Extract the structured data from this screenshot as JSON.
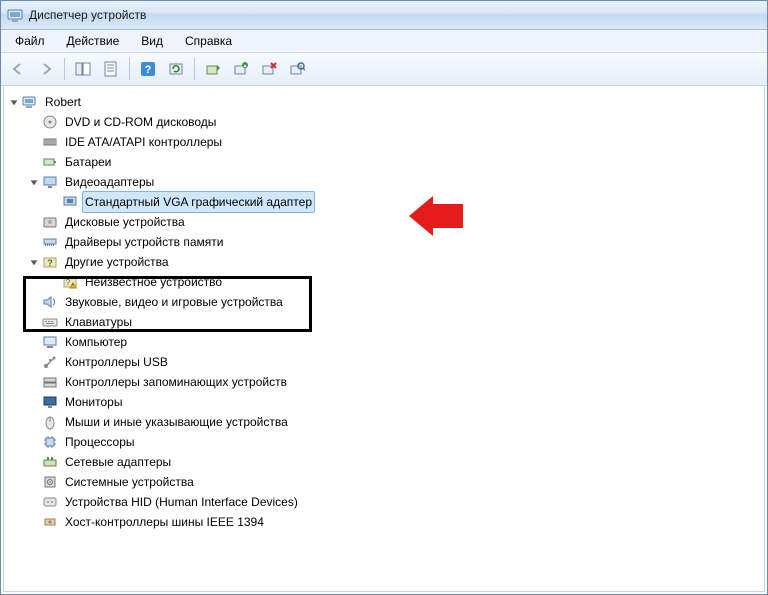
{
  "window": {
    "title": "Диспетчер устройств"
  },
  "menu": {
    "file": "Файл",
    "action": "Действие",
    "view": "Вид",
    "help": "Справка"
  },
  "toolbar": {
    "back": "back",
    "forward": "forward",
    "show_hide": "show-hide-console",
    "properties": "properties",
    "help": "help",
    "refresh": "refresh",
    "update_driver": "update-driver",
    "uninstall": "uninstall",
    "disable": "disable",
    "scan": "scan-hardware"
  },
  "tree": {
    "root": {
      "label": "Robert",
      "icon": "computer-root"
    },
    "items": [
      {
        "label": "DVD и CD-ROM дисководы",
        "icon": "cd-drive",
        "expanded": false
      },
      {
        "label": "IDE ATA/ATAPI контроллеры",
        "icon": "ide",
        "expanded": false
      },
      {
        "label": "Батареи",
        "icon": "battery",
        "expanded": false
      },
      {
        "label": "Видеоадаптеры",
        "icon": "display",
        "expanded": true,
        "children": [
          {
            "label": "Стандартный VGA графический адаптер",
            "icon": "display-chip",
            "selected": true
          }
        ]
      },
      {
        "label": "Дисковые устройства",
        "icon": "disk",
        "expanded": false
      },
      {
        "label": "Драйверы устройств памяти",
        "icon": "memory",
        "expanded": false
      },
      {
        "label": "Другие устройства",
        "icon": "unknown-cat",
        "expanded": true,
        "children": [
          {
            "label": "Неизвестное устройство",
            "icon": "unknown-warn"
          }
        ]
      },
      {
        "label": "Звуковые, видео и игровые устройства",
        "icon": "sound",
        "expanded": false
      },
      {
        "label": "Клавиатуры",
        "icon": "keyboard",
        "expanded": false
      },
      {
        "label": "Компьютер",
        "icon": "computer",
        "expanded": false
      },
      {
        "label": "Контроллеры USB",
        "icon": "usb",
        "expanded": false
      },
      {
        "label": "Контроллеры запоминающих устройств",
        "icon": "storage-ctrl",
        "expanded": false
      },
      {
        "label": "Мониторы",
        "icon": "monitor",
        "expanded": false
      },
      {
        "label": "Мыши и иные указывающие устройства",
        "icon": "mouse",
        "expanded": false
      },
      {
        "label": "Процессоры",
        "icon": "cpu",
        "expanded": false
      },
      {
        "label": "Сетевые адаптеры",
        "icon": "network",
        "expanded": false
      },
      {
        "label": "Системные устройства",
        "icon": "system",
        "expanded": false
      },
      {
        "label": "Устройства HID (Human Interface Devices)",
        "icon": "hid",
        "expanded": false
      },
      {
        "label": "Хост-контроллеры шины IEEE 1394",
        "icon": "ieee1394",
        "expanded": false
      }
    ]
  },
  "annotations": {
    "arrow_target": "Стандартный VGA графический адаптер",
    "box_targets": [
      "Другие устройства",
      "Неизвестное устройство"
    ]
  }
}
